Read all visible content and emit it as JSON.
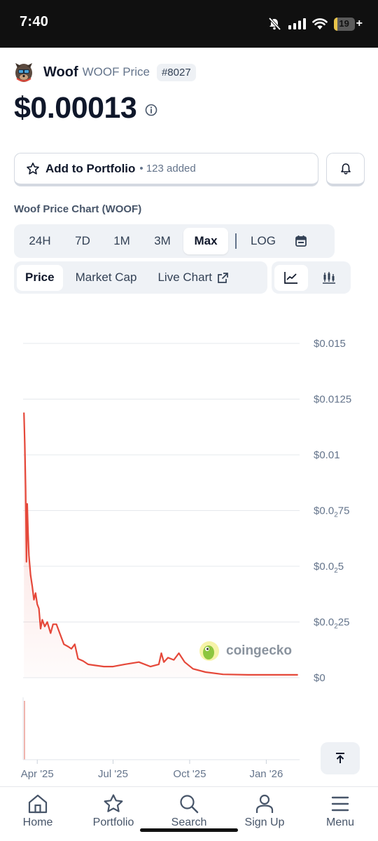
{
  "status_bar": {
    "time": "7:40",
    "battery": "19",
    "battery_level": 0.19
  },
  "coin": {
    "name": "Woof",
    "subtitle": "WOOF Price",
    "rank": "#8027",
    "price": "$0.00013"
  },
  "portfolio": {
    "label": "Add to Portfolio",
    "count": "• 123 added"
  },
  "chart_title": "Woof Price Chart (WOOF)",
  "range_tabs": [
    "24H",
    "7D",
    "1M",
    "3M",
    "Max"
  ],
  "range_active": "Max",
  "log_label": "LOG",
  "type_tabs": [
    "Price",
    "Market Cap",
    "Live Chart"
  ],
  "type_active": "Price",
  "watermark": "coingecko",
  "nav": [
    "Home",
    "Portfolio",
    "Search",
    "Sign Up",
    "Menu"
  ],
  "colors": {
    "line": "#e5483a",
    "accent_dark": "#0f172a",
    "muted": "#64748b",
    "tab_bg": "#eff2f6"
  },
  "chart_data": {
    "type": "line",
    "ylim": [
      0,
      0.015
    ],
    "y_ticks": [
      {
        "value": 0.015,
        "label": "$0.015"
      },
      {
        "value": 0.0125,
        "label": "$0.0125"
      },
      {
        "value": 0.01,
        "label": "$0.01"
      },
      {
        "value": 0.0075,
        "prefix": "$0.0",
        "sub": "2",
        "suffix": "75"
      },
      {
        "value": 0.005,
        "prefix": "$0.0",
        "sub": "2",
        "suffix": "5"
      },
      {
        "value": 0.0025,
        "prefix": "$0.0",
        "sub": "2",
        "suffix": "25"
      },
      {
        "value": 0,
        "label": "$0"
      }
    ],
    "x_range": [
      "2025-03-15",
      "2026-02-10"
    ],
    "x_ticks": [
      {
        "date": "2025-04-01",
        "label": "Apr '25"
      },
      {
        "date": "2025-07-01",
        "label": "Jul '25"
      },
      {
        "date": "2025-10-01",
        "label": "Oct '25"
      },
      {
        "date": "2026-01-01",
        "label": "Jan '26"
      }
    ],
    "series": [
      {
        "points": [
          [
            "2025-03-16",
            0.0119
          ],
          [
            "2025-03-17",
            0.0105
          ],
          [
            "2025-03-18",
            0.0085
          ],
          [
            "2025-03-19",
            0.0052
          ],
          [
            "2025-03-20",
            0.0078
          ],
          [
            "2025-03-21",
            0.0065
          ],
          [
            "2025-03-22",
            0.0055
          ],
          [
            "2025-03-24",
            0.0046
          ],
          [
            "2025-03-26",
            0.0041
          ],
          [
            "2025-03-28",
            0.0035
          ],
          [
            "2025-03-30",
            0.0038
          ],
          [
            "2025-04-01",
            0.0033
          ],
          [
            "2025-04-03",
            0.0031
          ],
          [
            "2025-04-05",
            0.0022
          ],
          [
            "2025-04-07",
            0.0026
          ],
          [
            "2025-04-10",
            0.0023
          ],
          [
            "2025-04-13",
            0.0025
          ],
          [
            "2025-04-17",
            0.002
          ],
          [
            "2025-04-20",
            0.0024
          ],
          [
            "2025-04-24",
            0.0024
          ],
          [
            "2025-04-28",
            0.002
          ],
          [
            "2025-05-03",
            0.0015
          ],
          [
            "2025-05-08",
            0.0014
          ],
          [
            "2025-05-12",
            0.0013
          ],
          [
            "2025-05-16",
            0.0015
          ],
          [
            "2025-05-20",
            0.00085
          ],
          [
            "2025-05-26",
            0.00075
          ],
          [
            "2025-06-01",
            0.0006
          ],
          [
            "2025-06-10",
            0.00055
          ],
          [
            "2025-06-20",
            0.0005
          ],
          [
            "2025-07-01",
            0.0005
          ],
          [
            "2025-07-15",
            0.0006
          ],
          [
            "2025-08-01",
            0.0007
          ],
          [
            "2025-08-15",
            0.0005
          ],
          [
            "2025-08-25",
            0.0006
          ],
          [
            "2025-08-28",
            0.0011
          ],
          [
            "2025-08-31",
            0.0007
          ],
          [
            "2025-09-05",
            0.0009
          ],
          [
            "2025-09-12",
            0.0008
          ],
          [
            "2025-09-18",
            0.0011
          ],
          [
            "2025-09-25",
            0.0007
          ],
          [
            "2025-10-05",
            0.0004
          ],
          [
            "2025-10-20",
            0.00025
          ],
          [
            "2025-11-10",
            0.00015
          ],
          [
            "2025-12-10",
            0.00013
          ],
          [
            "2026-01-10",
            0.00013
          ],
          [
            "2026-02-08",
            0.00013
          ]
        ]
      }
    ],
    "grid": true
  }
}
